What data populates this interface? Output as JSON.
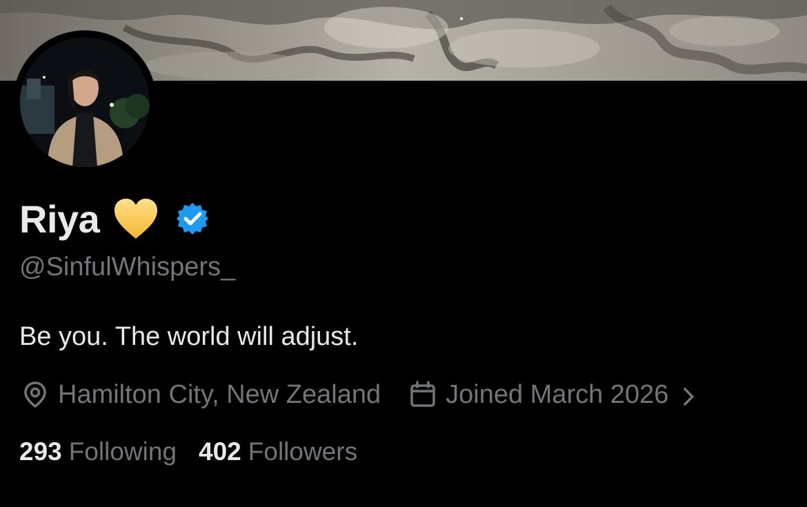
{
  "profile": {
    "display_name": "Riya",
    "handle": "@SinfulWhispers_",
    "bio": "Be you. The world will adjust.",
    "location": "Hamilton City, New Zealand",
    "joined": "Joined March 2026",
    "verified": true
  },
  "stats": {
    "following_count": "293",
    "following_label": "Following",
    "followers_count": "402",
    "followers_label": "Followers"
  },
  "icons": {
    "heart": "yellow-heart-emoji",
    "verified": "verified-badge-icon",
    "location": "location-pin-icon",
    "calendar": "calendar-icon",
    "chevron": "chevron-right-icon"
  },
  "colors": {
    "background": "#000000",
    "primary_text": "#e7e9ea",
    "secondary_text": "#71767b",
    "verified_blue": "#1d9bf0",
    "heart_yellow": "#ffcc4d"
  }
}
